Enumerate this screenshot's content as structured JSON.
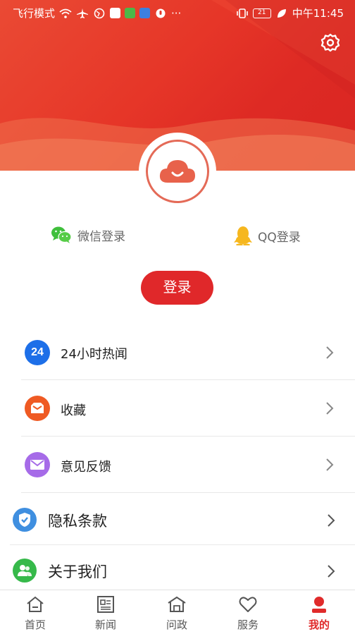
{
  "status_bar": {
    "left_text": "飞行模式",
    "more": "···",
    "battery": "21",
    "time": "中午11:45"
  },
  "icons": {
    "settings": "gear-icon",
    "avatar": "cloud-smile-icon",
    "wechat": "wechat-icon",
    "qq": "qq-penguin-icon"
  },
  "social": {
    "wechat_label": "微信登录",
    "qq_label": "QQ登录"
  },
  "login_button": "登录",
  "menu": [
    {
      "label": "24小时热闻",
      "icon": "24-hours-icon",
      "color": "#1d6fe8",
      "icon_text": "24"
    },
    {
      "label": "收藏",
      "icon": "favorite-box-icon",
      "color": "#ef5a23"
    },
    {
      "label": "意见反馈",
      "icon": "mail-icon",
      "color": "#a66be8"
    },
    {
      "label": "隐私条款",
      "icon": "shield-check-icon",
      "color": "#3f8fe0"
    },
    {
      "label": "关于我们",
      "icon": "people-icon",
      "color": "#36b94a"
    }
  ],
  "tabs": [
    {
      "label": "首页",
      "icon": "home-icon"
    },
    {
      "label": "新闻",
      "icon": "newspaper-icon"
    },
    {
      "label": "问政",
      "icon": "government-icon"
    },
    {
      "label": "服务",
      "icon": "heart-icon"
    },
    {
      "label": "我的",
      "icon": "user-icon",
      "active": true
    }
  ],
  "colors": {
    "brand_red": "#e0282a",
    "header_red": "#e63628"
  }
}
